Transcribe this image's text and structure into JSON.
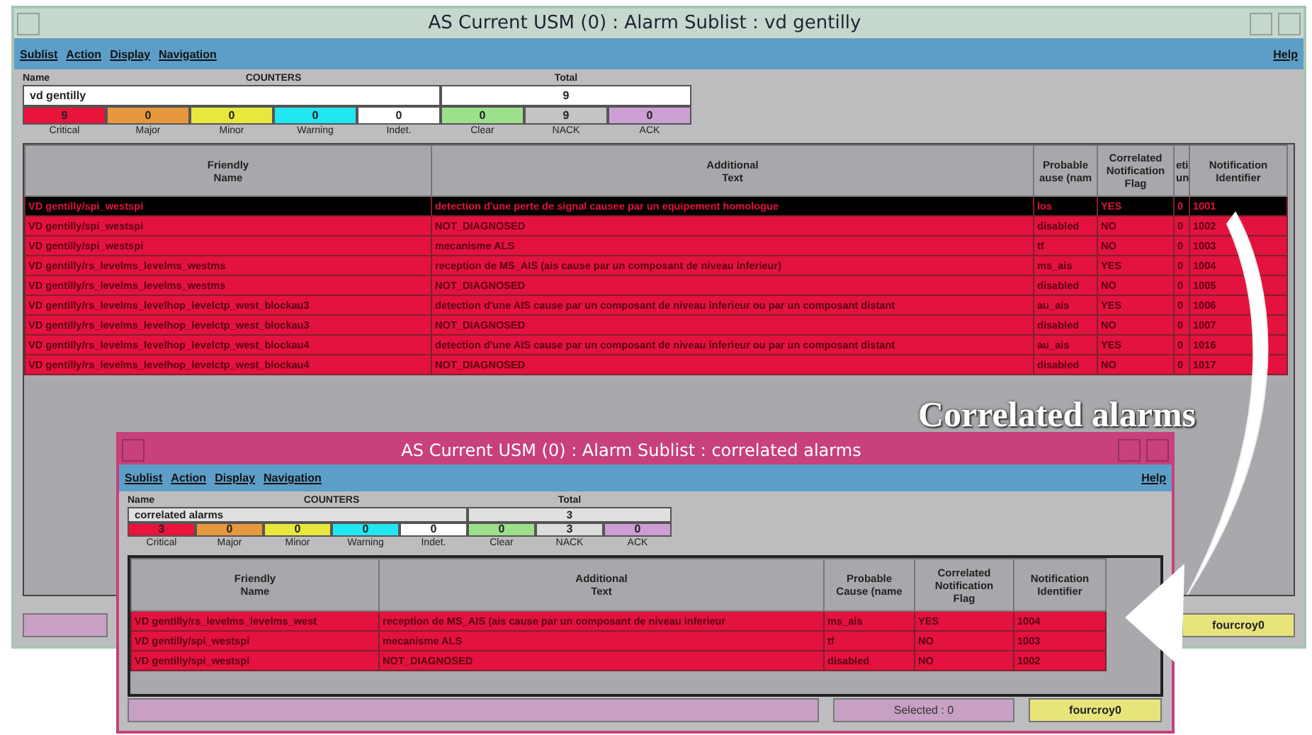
{
  "windows": [
    {
      "title": "AS Current USM (0) : Alarm Sublist : vd gentilly",
      "menu": [
        "Sublist",
        "Action",
        "Display",
        "Navigation"
      ],
      "help": "Help",
      "name_label": "Name",
      "counters_label": "COUNTERS",
      "total_label": "Total",
      "name_value": "vd gentilly",
      "total_value": "9",
      "counters": [
        {
          "label": "Critical",
          "value": "9",
          "color": "#e8143c"
        },
        {
          "label": "Major",
          "value": "0",
          "color": "#e8983c"
        },
        {
          "label": "Minor",
          "value": "0",
          "color": "#e8e83c"
        },
        {
          "label": "Warning",
          "value": "0",
          "color": "#22e6f0"
        },
        {
          "label": "Indet.",
          "value": "0",
          "color": "#ffffff"
        },
        {
          "label": "Clear",
          "value": "0",
          "color": "#9ce08c"
        },
        {
          "label": "NACK",
          "value": "9",
          "color": "#c4c4c4"
        },
        {
          "label": "ACK",
          "value": "0",
          "color": "#cc9ed4"
        }
      ],
      "columns": [
        "Friendly\nName",
        "Additional\nText",
        "Probable\nause (nam",
        "Correlated\nNotification\nFlag",
        "eti\nun",
        "Notification\nIdentifier"
      ],
      "rows": [
        {
          "selected": true,
          "cells": [
            "VD gentilly/spi_westspi",
            "detection d'une perte de signal causee par un equipement homologue",
            "los",
            "YES",
            "0",
            "1001"
          ]
        },
        {
          "selected": false,
          "cells": [
            "VD gentilly/spi_westspi",
            "NOT_DIAGNOSED",
            "disabled",
            "NO",
            "0",
            "1002"
          ]
        },
        {
          "selected": false,
          "cells": [
            "VD gentilly/spi_westspi",
            "mecanisme ALS",
            "tf",
            "NO",
            "0",
            "1003"
          ]
        },
        {
          "selected": false,
          "cells": [
            "VD gentilly/rs_levelms_levelms_westms",
            "reception de MS_AIS (ais cause par un composant de niveau inferieur)",
            "ms_ais",
            "YES",
            "0",
            "1004"
          ]
        },
        {
          "selected": false,
          "cells": [
            "VD gentilly/rs_levelms_levelms_westms",
            "NOT_DIAGNOSED",
            "disabled",
            "NO",
            "0",
            "1005"
          ]
        },
        {
          "selected": false,
          "cells": [
            "VD gentilly/rs_levelms_levelhop_levelctp_west_blockau3",
            "detection d'une AIS cause par un composant de niveau inferieur ou par un composant distant",
            "au_ais",
            "YES",
            "0",
            "1006"
          ]
        },
        {
          "selected": false,
          "cells": [
            "VD gentilly/rs_levelms_levelhop_levelctp_west_blockau3",
            "NOT_DIAGNOSED",
            "disabled",
            "NO",
            "0",
            "1007"
          ]
        },
        {
          "selected": false,
          "cells": [
            "VD gentilly/rs_levelms_levelhop_levelctp_west_blockau4",
            "detection d'une AIS cause par un composant de niveau inferieur ou par un composant distant",
            "au_ais",
            "YES",
            "0",
            "1016"
          ]
        },
        {
          "selected": false,
          "cells": [
            "VD gentilly/rs_levelms_levelhop_levelctp_west_blockau4",
            "NOT_DIAGNOSED",
            "disabled",
            "NO",
            "0",
            "1017"
          ]
        }
      ],
      "status": [
        {
          "kind": "message"
        },
        {
          "kind": "user",
          "text": "fourcroy0"
        }
      ]
    },
    {
      "title": "AS Current USM (0) : Alarm Sublist : correlated alarms",
      "menu": [
        "Sublist",
        "Action",
        "Display",
        "Navigation"
      ],
      "help": "Help",
      "name_label": "Name",
      "counters_label": "COUNTERS",
      "total_label": "Total",
      "name_value": "correlated alarms",
      "total_value": "3",
      "counters": [
        {
          "label": "Critical",
          "value": "3",
          "color": "#e8143c"
        },
        {
          "label": "Major",
          "value": "0",
          "color": "#e8983c"
        },
        {
          "label": "Minor",
          "value": "0",
          "color": "#e8e83c"
        },
        {
          "label": "Warning",
          "value": "0",
          "color": "#22e6f0"
        },
        {
          "label": "Indet.",
          "value": "0",
          "color": "#ffffff"
        },
        {
          "label": "Clear",
          "value": "0",
          "color": "#9ce08c"
        },
        {
          "label": "NACK",
          "value": "3",
          "color": "#dcdcdc"
        },
        {
          "label": "ACK",
          "value": "0",
          "color": "#cc9ed4"
        }
      ],
      "columns": [
        "Friendly\nName",
        "Additional\nText",
        "Probable\nCause (name",
        "Correlated\nNotification\nFlag",
        "Notification\nIdentifier"
      ],
      "rows": [
        {
          "selected": false,
          "cells": [
            "VD gentilly/rs_levelms_levelms_west",
            "reception de MS_AIS (ais cause par un composant de niveau inferieur",
            "ms_ais",
            "YES",
            "1004"
          ]
        },
        {
          "selected": false,
          "cells": [
            "VD gentilly/spi_westspi",
            "mecanisme ALS",
            "tf",
            "NO",
            "1003"
          ]
        },
        {
          "selected": false,
          "cells": [
            "VD gentilly/spi_westspi",
            "NOT_DIAGNOSED",
            "disabled",
            "NO",
            "1002"
          ]
        }
      ],
      "status": [
        {
          "kind": "message"
        },
        {
          "kind": "count",
          "text": "Selected : 0"
        },
        {
          "kind": "user",
          "text": "fourcroy0"
        }
      ]
    }
  ],
  "annotation": {
    "text": "Correlated alarms"
  }
}
